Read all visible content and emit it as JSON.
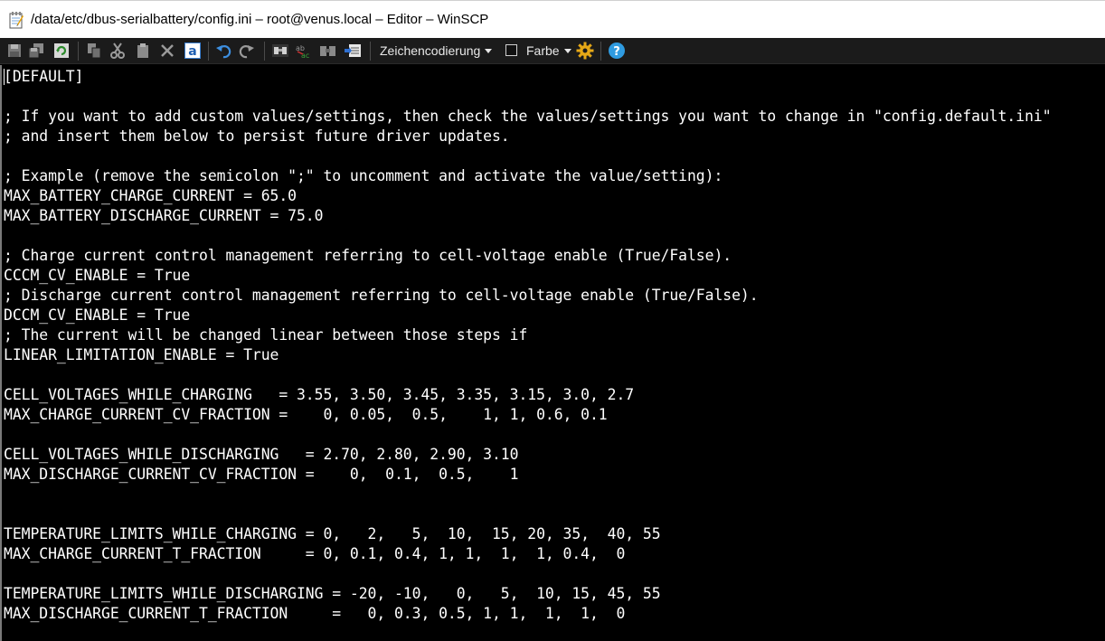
{
  "window": {
    "title": "/data/etc/dbus-serialbattery/config.ini – root@venus.local – Editor – WinSCP"
  },
  "toolbar": {
    "encoding_label": "Zeichencodierung",
    "color_label": "Farbe",
    "color_checked": false,
    "help_label": "?",
    "font_label": "a"
  },
  "editor": {
    "lines": [
      "[DEFAULT]",
      "",
      "; If you want to add custom values/settings, then check the values/settings you want to change in \"config.default.ini\"",
      "; and insert them below to persist future driver updates.",
      "",
      "; Example (remove the semicolon \";\" to uncomment and activate the value/setting):",
      "MAX_BATTERY_CHARGE_CURRENT = 65.0",
      "MAX_BATTERY_DISCHARGE_CURRENT = 75.0",
      "",
      "; Charge current control management referring to cell-voltage enable (True/False).",
      "CCCM_CV_ENABLE = True",
      "; Discharge current control management referring to cell-voltage enable (True/False).",
      "DCCM_CV_ENABLE = True",
      "; The current will be changed linear between those steps if",
      "LINEAR_LIMITATION_ENABLE = True",
      "",
      "CELL_VOLTAGES_WHILE_CHARGING   = 3.55, 3.50, 3.45, 3.35, 3.15, 3.0, 2.7",
      "MAX_CHARGE_CURRENT_CV_FRACTION =    0, 0.05,  0.5,    1, 1, 0.6, 0.1",
      "",
      "CELL_VOLTAGES_WHILE_DISCHARGING   = 2.70, 2.80, 2.90, 3.10",
      "MAX_DISCHARGE_CURRENT_CV_FRACTION =    0,  0.1,  0.5,    1",
      "",
      "",
      "TEMPERATURE_LIMITS_WHILE_CHARGING = 0,   2,   5,  10,  15, 20, 35,  40, 55",
      "MAX_CHARGE_CURRENT_T_FRACTION     = 0, 0.1, 0.4, 1, 1,  1,  1, 0.4,  0",
      "",
      "TEMPERATURE_LIMITS_WHILE_DISCHARGING = -20, -10,   0,   5,  10, 15, 45, 55",
      "MAX_DISCHARGE_CURRENT_T_FRACTION     =   0, 0.3, 0.5, 1, 1,  1,  1,  0"
    ]
  }
}
